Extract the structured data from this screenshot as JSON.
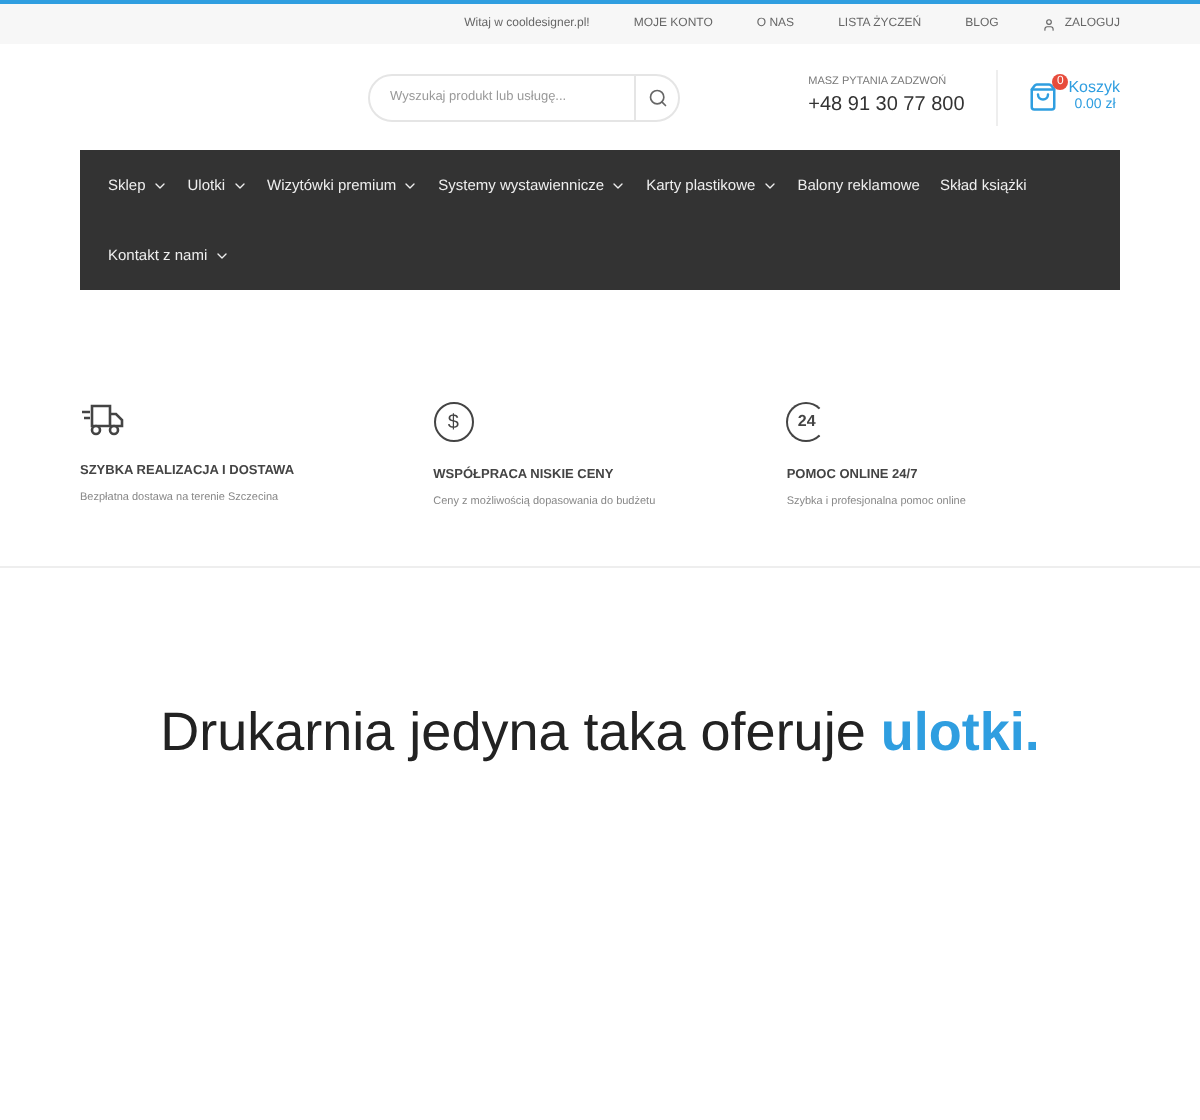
{
  "top_bar": {
    "welcome": "Witaj w cooldesigner.pl!",
    "links": [
      "MOJE KONTO",
      "O NAS",
      "LISTA ŻYCZEŃ",
      "BLOG"
    ],
    "login": "ZALOGUJ"
  },
  "header": {
    "search": {
      "placeholder": "Wyszukaj produkt lub usługę..."
    },
    "phone": {
      "caption": "MASZ PYTANIA ZADZWOŃ",
      "number": "+48 91 30 77 800"
    },
    "cart": {
      "count": "0",
      "label": "Koszyk",
      "total": "0.00 zł"
    }
  },
  "nav": [
    {
      "label": "Sklep",
      "dropdown": true
    },
    {
      "label": "Ulotki",
      "dropdown": true
    },
    {
      "label": "Wizytówki premium",
      "dropdown": true
    },
    {
      "label": "Systemy wystawiennicze",
      "dropdown": true
    },
    {
      "label": "Karty plastikowe",
      "dropdown": true
    },
    {
      "label": "Balony reklamowe",
      "dropdown": false
    },
    {
      "label": "Skład książki",
      "dropdown": false
    },
    {
      "label": "Kontakt z nami",
      "dropdown": true
    }
  ],
  "features": [
    {
      "kind": "truck",
      "title": "SZYBKA REALIZACJA I DOSTAWA",
      "text": "Bezpłatna dostawa na terenie Szczecina"
    },
    {
      "kind": "dollar",
      "icon_label": "$",
      "title": "WSPÓŁPRACA NISKIE CENY",
      "text": "Ceny z możliwością dopasowania do budżetu"
    },
    {
      "kind": "clock24",
      "icon_label": "24",
      "title": "POMOC ONLINE 24/7",
      "text": "Szybka i profesjonalna pomoc online"
    }
  ],
  "hero": {
    "text": "Drukarnia jedyna taka oferuje",
    "highlight": "ulotki."
  }
}
